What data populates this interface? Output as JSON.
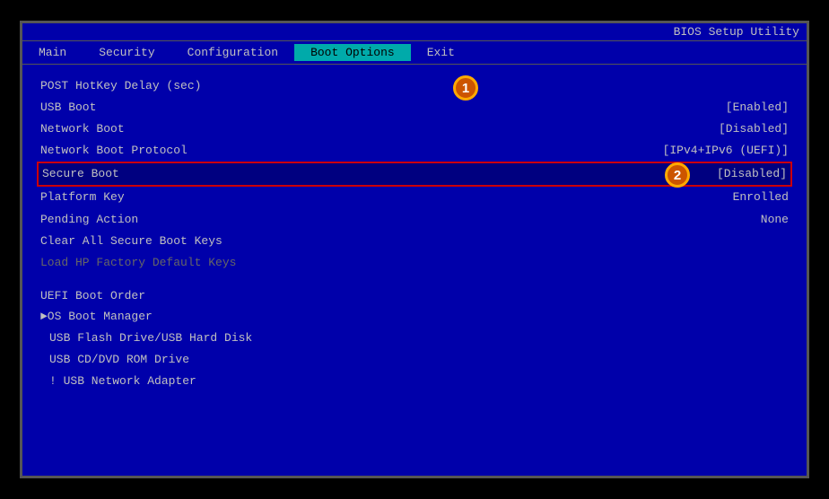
{
  "title": "BIOS Setup Utility",
  "menu": {
    "items": [
      {
        "id": "main",
        "label": "Main",
        "active": false
      },
      {
        "id": "security",
        "label": "Security",
        "active": false
      },
      {
        "id": "configuration",
        "label": "Configuration",
        "active": false
      },
      {
        "id": "boot-options",
        "label": "Boot Options",
        "active": true
      },
      {
        "id": "exit",
        "label": "Exit",
        "active": false
      }
    ]
  },
  "settings": [
    {
      "id": "post-hotkey",
      "label": "POST HotKey Delay (sec)",
      "value": "",
      "dimmed": false
    },
    {
      "id": "usb-boot",
      "label": "USB Boot",
      "value": "[Enabled]",
      "dimmed": false
    },
    {
      "id": "network-boot",
      "label": "Network Boot",
      "value": "[Disabled]",
      "dimmed": false
    },
    {
      "id": "network-boot-protocol",
      "label": "Network Boot Protocol",
      "value": "[IPv4+IPv6 (UEFI)]",
      "dimmed": false
    },
    {
      "id": "secure-boot",
      "label": "Secure Boot",
      "value": "[Disabled]",
      "highlighted": true,
      "dimmed": false
    },
    {
      "id": "platform-key",
      "label": "Platform Key",
      "value": "Enrolled",
      "dimmed": false
    },
    {
      "id": "pending-action",
      "label": "Pending Action",
      "value": "None",
      "dimmed": false
    },
    {
      "id": "clear-keys",
      "label": "Clear All Secure Boot Keys",
      "value": "",
      "dimmed": false
    },
    {
      "id": "load-hp",
      "label": "Load HP Factory Default Keys",
      "value": "",
      "dimmed": true
    }
  ],
  "boot_order_header": "UEFI Boot Order",
  "boot_order_items": [
    {
      "id": "os-boot-manager",
      "label": "OS Boot Manager",
      "prefix": "►",
      "dimmed": false
    },
    {
      "id": "usb-flash",
      "label": "USB Flash Drive/USB Hard Disk",
      "prefix": " ",
      "dimmed": false
    },
    {
      "id": "usb-cd",
      "label": "USB CD/DVD ROM Drive",
      "prefix": " ",
      "dimmed": false
    },
    {
      "id": "usb-network",
      "label": "! USB Network Adapter",
      "prefix": " ",
      "dimmed": false
    }
  ],
  "badges": [
    {
      "id": "badge-1",
      "label": "1"
    },
    {
      "id": "badge-2",
      "label": "2"
    }
  ]
}
